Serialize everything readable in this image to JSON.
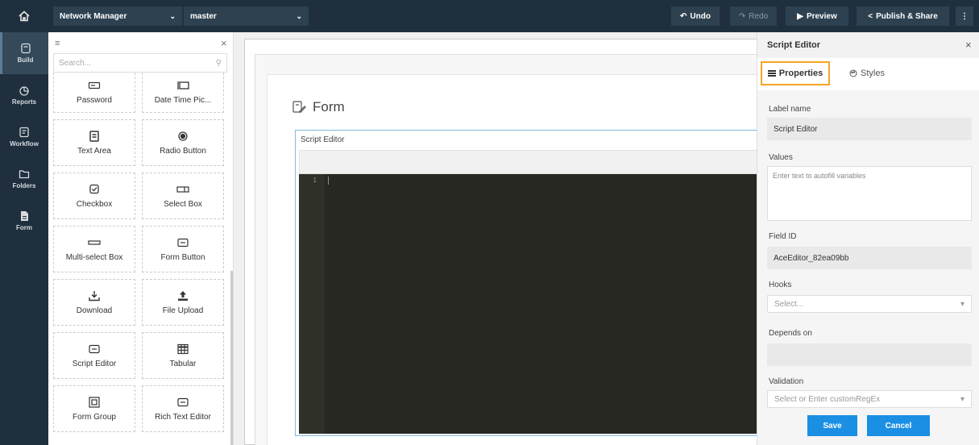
{
  "topbar": {
    "app_select": "Network Manager",
    "branch_select": "master",
    "undo_label": "Undo",
    "redo_label": "Redo",
    "preview_label": "Preview",
    "publish_label": "Publish & Share",
    "more_label": "⋮"
  },
  "nav": {
    "items": [
      {
        "label": "Build",
        "icon": "build-icon"
      },
      {
        "label": "Reports",
        "icon": "reports-icon"
      },
      {
        "label": "Workflow",
        "icon": "workflow-icon"
      },
      {
        "label": "Folders",
        "icon": "folder-icon"
      },
      {
        "label": "Form",
        "icon": "form-icon"
      }
    ]
  },
  "components": {
    "search_placeholder": "Search...",
    "items": [
      {
        "label": "Password",
        "icon": "password-icon"
      },
      {
        "label": "Date Time Pic...",
        "icon": "datetime-icon"
      },
      {
        "label": "Text Area",
        "icon": "textarea-icon"
      },
      {
        "label": "Radio Button",
        "icon": "radio-icon"
      },
      {
        "label": "Checkbox",
        "icon": "checkbox-icon"
      },
      {
        "label": "Select Box",
        "icon": "selectbox-icon"
      },
      {
        "label": "Multi-select Box",
        "icon": "multiselect-icon"
      },
      {
        "label": "Form Button",
        "icon": "form-button-icon"
      },
      {
        "label": "Download",
        "icon": "download-icon"
      },
      {
        "label": "File Upload",
        "icon": "upload-icon"
      },
      {
        "label": "Script Editor",
        "icon": "script-editor-icon"
      },
      {
        "label": "Tabular",
        "icon": "table-icon"
      },
      {
        "label": "Form Group",
        "icon": "form-group-icon"
      },
      {
        "label": "Rich Text Editor",
        "icon": "rich-text-icon"
      }
    ]
  },
  "canvas": {
    "form_title": "Form",
    "editor_label": "Script Editor",
    "line_number": "1"
  },
  "props": {
    "title": "Script Editor",
    "tab_properties": "Properties",
    "tab_styles": "Styles",
    "label_name_label": "Label name",
    "label_name_value": "Script Editor",
    "values_label": "Values",
    "values_placeholder": "Enter text to autofill variables",
    "field_id_label": "Field ID",
    "field_id_value": "AceEditor_82ea09bb",
    "hooks_label": "Hooks",
    "hooks_placeholder": "Select...",
    "depends_label": "Depends on",
    "validation_label": "Validation",
    "validation_placeholder": "Select or Enter customRegEx",
    "save_label": "Save",
    "cancel_label": "Cancel"
  },
  "colors": {
    "topbar": "#1f2f3d",
    "accent_blue": "#1a8fe3",
    "tab_highlight": "#f5a623",
    "editor_bg": "#272822"
  }
}
